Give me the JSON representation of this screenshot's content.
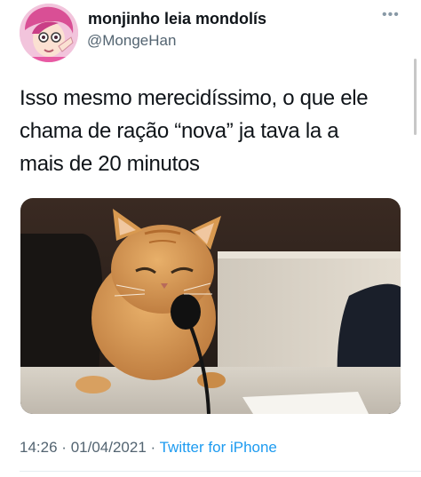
{
  "tweet": {
    "display_name": "monjinho leia mondolís",
    "handle": "@MongeHan",
    "more_icon": "more-horizontal-icon",
    "text": "Isso mesmo merecidíssimo, o que ele\nchama de ração “nova” ja tava la a\nmais de 20 minutos",
    "time": "14:26",
    "separator": "·",
    "date": "01/04/2021",
    "source": "Twitter for iPhone",
    "source_color": "#1d9bf0"
  }
}
